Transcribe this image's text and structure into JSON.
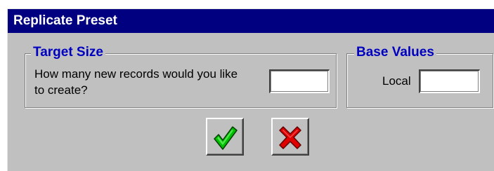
{
  "window": {
    "title": "Replicate Preset"
  },
  "target_size": {
    "legend": "Target Size",
    "question": "How many new records would you like to create?",
    "records_value": ""
  },
  "base_values": {
    "legend": "Base Values",
    "local_label": "Local",
    "local_value": ""
  },
  "buttons": {
    "ok_icon": "green-checkmark-icon",
    "cancel_icon": "red-x-icon"
  },
  "colors": {
    "titlebar": "#000080",
    "legend_text": "#0000c0",
    "dialog_background": "#c0c0c0",
    "check_green": "#00c000",
    "x_red": "#e00000"
  }
}
